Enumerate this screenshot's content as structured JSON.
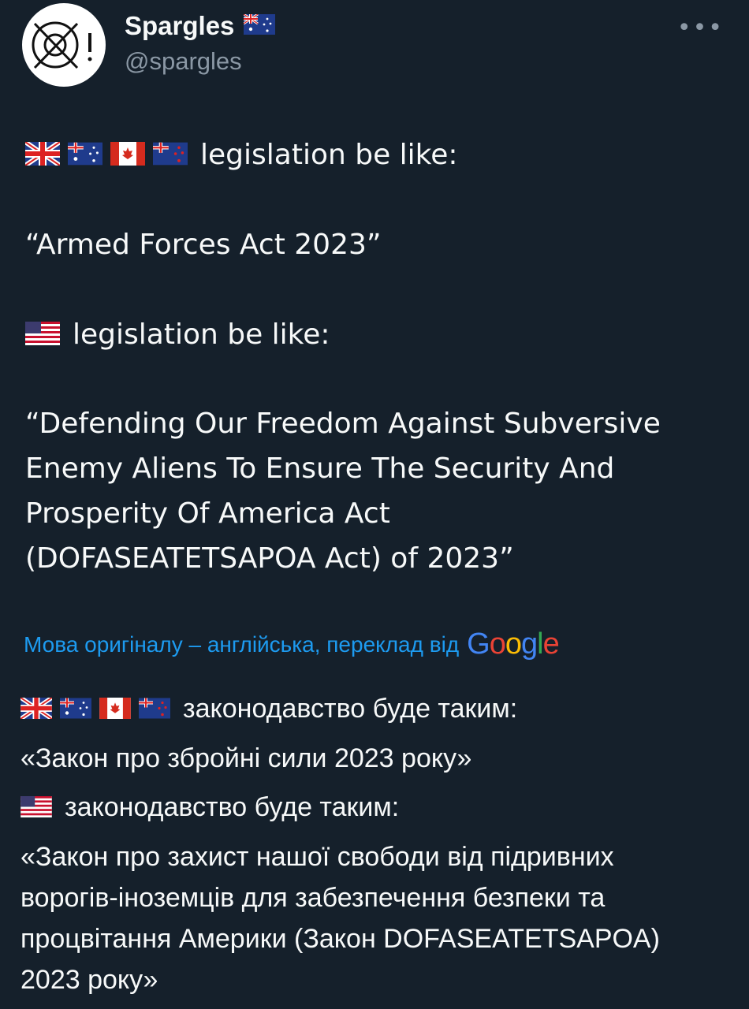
{
  "tweet": {
    "author_name": "Spargles",
    "author_handle": "@spargles",
    "more_label": "•••",
    "original_lines": [
      "legislation be like:",
      "“Armed Forces Act 2023”",
      "legislation be like:",
      "“Defending Our Freedom Against Subversive",
      "Enemy Aliens To Ensure The Security And",
      "Prosperity Of America Act",
      "(DOFASEATETSAPOA Act) of 2023”"
    ],
    "translation_note": "Мова оригіналу – англійська, переклад від",
    "translation_provider": "Google",
    "translated_lines": [
      "законодавство буде таким:",
      "«Закон про збройні сили 2023 року»",
      "законодавство буде таким:",
      "«Закон про захист нашої свободи від підривних",
      "ворогів-іноземців для забезпечення безпеки та",
      "процвітання Америки (Закон DOFASEATETSAPOA)",
      "2023 року»"
    ]
  },
  "flags": [
    "uk-flag-icon",
    "australia-flag-icon",
    "canada-flag-icon",
    "new-zealand-flag-icon",
    "us-flag-icon"
  ],
  "colors": {
    "background": "#15202b",
    "text": "#f7f9f9",
    "muted": "#8b98a5",
    "link": "#1d9bf0"
  }
}
